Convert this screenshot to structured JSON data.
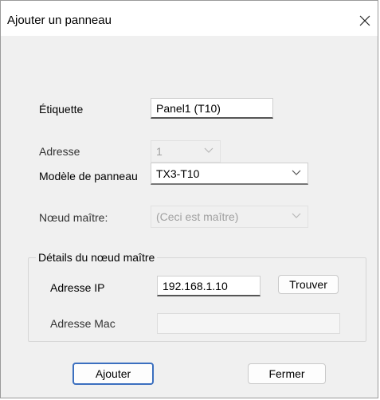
{
  "window": {
    "title": "Ajouter un panneau",
    "close_icon": "close-icon"
  },
  "form": {
    "label_label": "Étiquette",
    "label_value": "Panel1 (T10)",
    "address_label": "Adresse",
    "address_value": "1",
    "model_label": "Modèle de panneau",
    "model_value": "TX3-T10",
    "master_label": "Nœud maître:",
    "master_value": "(Ceci est maître)"
  },
  "master_details": {
    "title": "Détails du nœud maître",
    "ip_label": "Adresse IP",
    "ip_value": "192.168.1.10",
    "find_button": "Trouver",
    "mac_label": "Adresse Mac",
    "mac_value": ""
  },
  "buttons": {
    "add": "Ajouter",
    "close": "Fermer"
  },
  "colors": {
    "primary_border": "#3b6fbf",
    "dialog_bg": "#f0f0f0"
  }
}
